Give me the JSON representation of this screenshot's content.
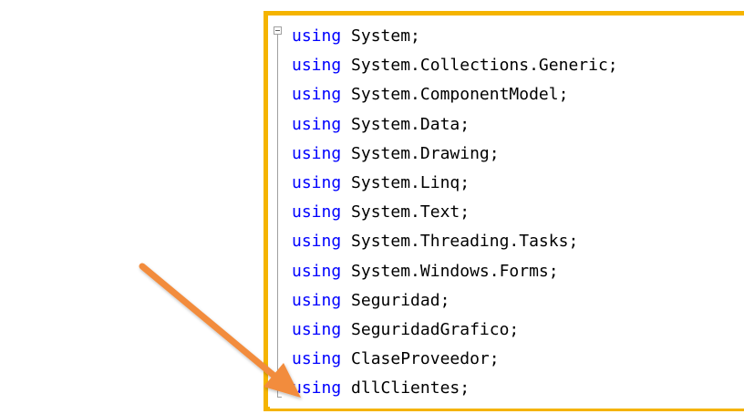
{
  "editor": {
    "keyword_color": "#0000ff",
    "text_color": "#000000",
    "frame_color": "#f5b400",
    "arrow_color": "#f28c3c",
    "fold_icon": "collapse-minus-icon",
    "lines": [
      {
        "keyword": "using",
        "namespace": "System;"
      },
      {
        "keyword": "using",
        "namespace": "System.Collections.Generic;"
      },
      {
        "keyword": "using",
        "namespace": "System.ComponentModel;"
      },
      {
        "keyword": "using",
        "namespace": "System.Data;"
      },
      {
        "keyword": "using",
        "namespace": "System.Drawing;"
      },
      {
        "keyword": "using",
        "namespace": "System.Linq;"
      },
      {
        "keyword": "using",
        "namespace": "System.Text;"
      },
      {
        "keyword": "using",
        "namespace": "System.Threading.Tasks;"
      },
      {
        "keyword": "using",
        "namespace": "System.Windows.Forms;"
      },
      {
        "keyword": "using",
        "namespace": "Seguridad;"
      },
      {
        "keyword": "using",
        "namespace": "SeguridadGrafico;"
      },
      {
        "keyword": "using",
        "namespace": "ClaseProveedor;"
      },
      {
        "keyword": "using",
        "namespace": "dllClientes;"
      }
    ]
  },
  "annotation": {
    "icon": "arrow-icon",
    "points_to_line": 13
  }
}
